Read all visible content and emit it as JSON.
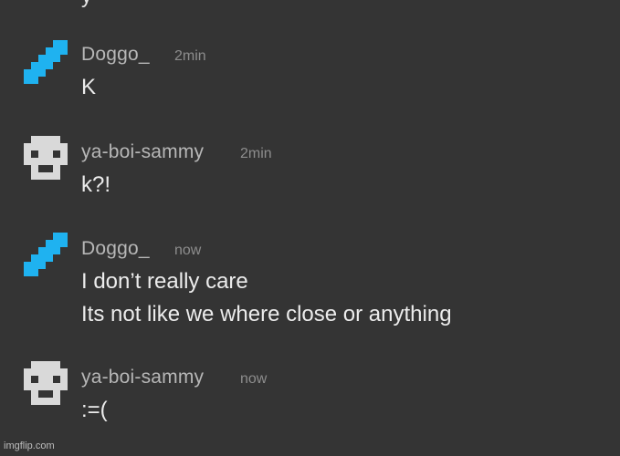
{
  "top_partial_text": "y",
  "messages": [
    {
      "avatar_icon": "diamond-sword-icon",
      "username": "Doggo_",
      "timestamp": "2min",
      "lines": [
        "K"
      ]
    },
    {
      "avatar_icon": "skull-icon",
      "username": "ya-boi-sammy",
      "timestamp": "2min",
      "lines": [
        "k?!"
      ]
    },
    {
      "avatar_icon": "diamond-sword-icon",
      "username": "Doggo_",
      "timestamp": "now",
      "lines": [
        "I don’t really care",
        "Its not like we where close or anything"
      ]
    },
    {
      "avatar_icon": "skull-icon",
      "username": "ya-boi-sammy",
      "timestamp": "now",
      "lines": [
        ":=("
      ]
    }
  ],
  "watermark": "imgflip.com",
  "colors": {
    "background": "#343434",
    "username": "#b7b7b7",
    "timestamp": "#8d8d8d",
    "message_text": "#ececec",
    "sword_blue": "#1fb2f0",
    "skull_gray": "#d9d9d9"
  }
}
